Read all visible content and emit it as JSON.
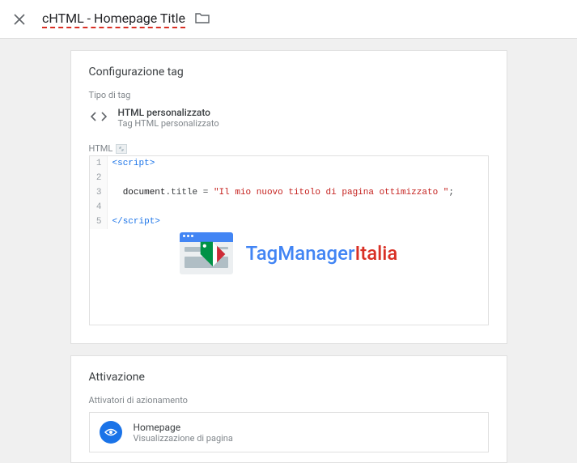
{
  "header": {
    "title": "cHTML - Homepage Title"
  },
  "config_card": {
    "title": "Configurazione tag",
    "type_label": "Tipo di tag",
    "tag_type_name": "HTML personalizzato",
    "tag_type_desc": "Tag HTML personalizzato",
    "html_label": "HTML",
    "code": {
      "l1": "<script>",
      "l2": "",
      "l3a": "  document",
      "l3b": ".title = ",
      "l3c": "\"Il mio nuovo titolo di pagina ottimizzato \"",
      "l3d": ";",
      "l4": "",
      "l5": "</script>"
    }
  },
  "watermark": {
    "part1": "TagManager",
    "part2": "Italia"
  },
  "activation_card": {
    "title": "Attivazione",
    "sub_label": "Attivatori di azionamento",
    "trigger_name": "Homepage",
    "trigger_desc": "Visualizzazione di pagina"
  }
}
